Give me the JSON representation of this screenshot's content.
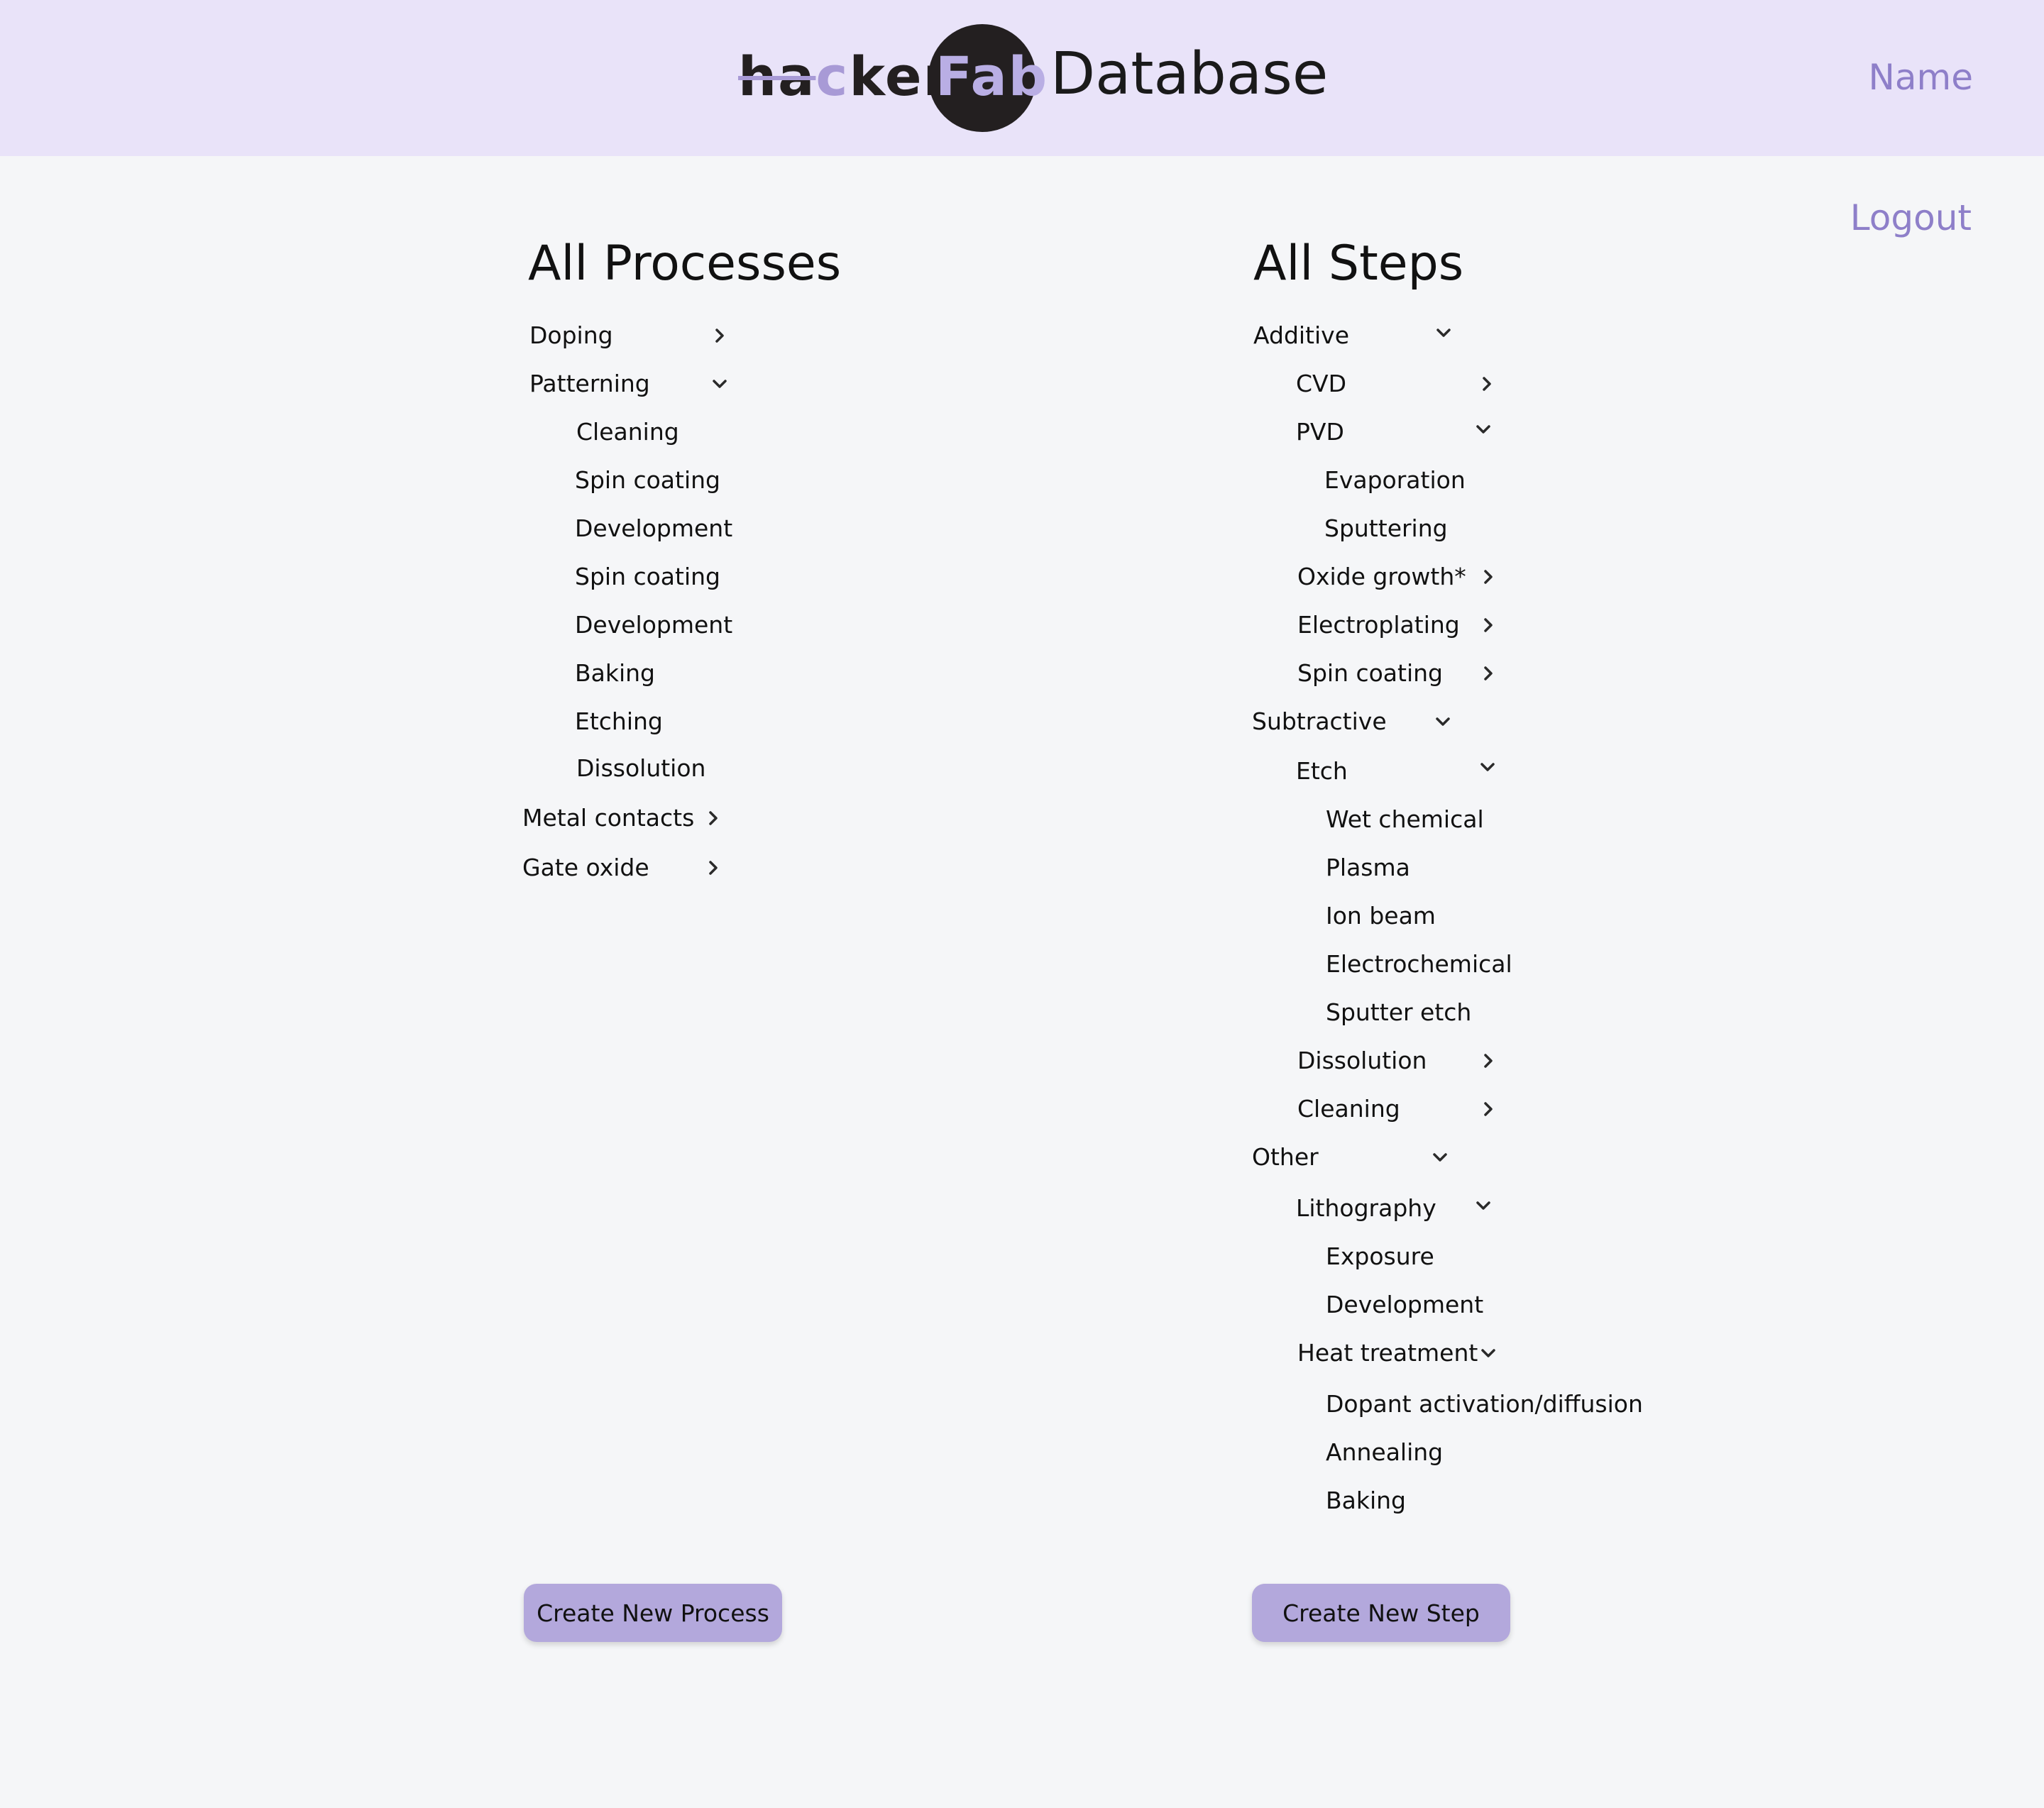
{
  "header": {
    "logo_text": "hackerFab",
    "logo_part_a": "ha",
    "logo_part_b": "c",
    "logo_part_c": "ker",
    "logo_part_d": "Fab",
    "title": "Database",
    "user_name": "Name",
    "logout_label": "Logout"
  },
  "processes": {
    "title": "All Processes",
    "items": [
      {
        "label": "Doping",
        "icon": "chevron-right-icon"
      },
      {
        "label": "Patterning",
        "icon": "chevron-down-icon"
      },
      {
        "label": "Cleaning"
      },
      {
        "label": "Spin coating"
      },
      {
        "label": "Development"
      },
      {
        "label": "Spin coating"
      },
      {
        "label": "Development"
      },
      {
        "label": "Baking"
      },
      {
        "label": "Etching"
      },
      {
        "label": "Dissolution"
      },
      {
        "label": "Metal contacts",
        "icon": "chevron-right-icon"
      },
      {
        "label": "Gate oxide",
        "icon": "chevron-right-icon"
      }
    ],
    "create_label": "Create New Process"
  },
  "steps": {
    "title": "All Steps",
    "items": [
      {
        "label": "Additive",
        "icon": "chevron-down-icon"
      },
      {
        "label": "CVD",
        "icon": "chevron-right-icon"
      },
      {
        "label": "PVD",
        "icon": "chevron-down-icon"
      },
      {
        "label": "Evaporation"
      },
      {
        "label": "Sputtering"
      },
      {
        "label": "Oxide growth*",
        "icon": "chevron-right-icon"
      },
      {
        "label": "Electroplating",
        "icon": "chevron-right-icon"
      },
      {
        "label": "Spin coating",
        "icon": "chevron-right-icon"
      },
      {
        "label": "Subtractive",
        "icon": "chevron-down-icon"
      },
      {
        "label": "Etch",
        "icon": "chevron-down-icon"
      },
      {
        "label": "Wet chemical"
      },
      {
        "label": "Plasma"
      },
      {
        "label": "Ion beam"
      },
      {
        "label": "Electrochemical"
      },
      {
        "label": "Sputter etch"
      },
      {
        "label": "Dissolution",
        "icon": "chevron-right-icon"
      },
      {
        "label": "Cleaning",
        "icon": "chevron-right-icon"
      },
      {
        "label": "Other",
        "icon": "chevron-down-icon"
      },
      {
        "label": "Lithography",
        "icon": "chevron-down-icon"
      },
      {
        "label": "Exposure"
      },
      {
        "label": "Development"
      },
      {
        "label": "Heat treatment",
        "icon": "chevron-down-icon"
      },
      {
        "label": "Dopant activation/diffusion"
      },
      {
        "label": "Annealing"
      },
      {
        "label": "Baking"
      }
    ],
    "create_label": "Create New Step"
  },
  "colors": {
    "header_bg": "#e9e3f9",
    "accent": "#8e7fc9",
    "button_bg": "#b3a8dc",
    "page_bg": "#f5f6f8"
  }
}
